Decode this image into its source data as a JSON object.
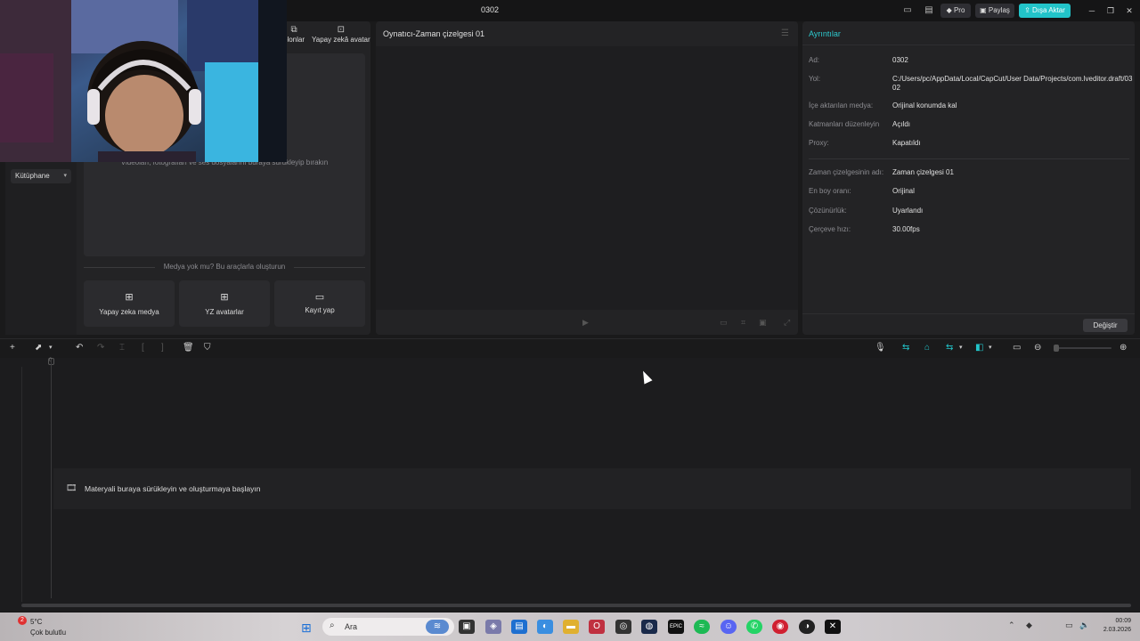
{
  "window": {
    "title": "0302",
    "pro_label": "Pro",
    "share_label": "Paylaş",
    "export_label": "Dışa Aktar"
  },
  "media_panel": {
    "tabs": [
      {
        "label": "blonlar",
        "icon": "template-icon"
      },
      {
        "label": "Yapay zekâ avatar",
        "icon": "ai-avatar-icon"
      }
    ],
    "library_label": "Kütüphane",
    "drop_hint": "Videoları, fotoğrafları ve ses dosyalarını buraya sürükleyip bırakın",
    "no_media_text": "Medya yok mu? Bu araçlarla oluşturun",
    "tools": [
      {
        "label": "Yapay zeka medya",
        "icon": "ai-media-icon"
      },
      {
        "label": "YZ avatarlar",
        "icon": "ai-avatar-icon"
      },
      {
        "label": "Kayıt yap",
        "icon": "record-icon"
      }
    ]
  },
  "player": {
    "title": "Oynatıcı-Zaman çizelgesi 01"
  },
  "details": {
    "title": "Ayrıntılar",
    "rows": [
      {
        "key": "Ad:",
        "value": "0302"
      },
      {
        "key": "Yol:",
        "value": "C:/Users/pc/AppData/Local/CapCut/User Data/Projects/com.lveditor.draft/0302"
      },
      {
        "key": "İçe aktarılan medya:",
        "value": "Orijinal konumda kal"
      },
      {
        "key": "Katmanları düzenleyin",
        "value": "Açıldı"
      },
      {
        "key": "Proxy:",
        "value": "Kapatıldı"
      }
    ],
    "timeline_rows": [
      {
        "key": "Zaman çizelgesinin adı:",
        "value": "Zaman çizelgesi 01"
      },
      {
        "key": "En boy oranı:",
        "value": "Orijinal"
      },
      {
        "key": "Çözünürlük:",
        "value": "Uyarlandı"
      },
      {
        "key": "Çerçeve hızı:",
        "value": "30.00fps"
      }
    ],
    "change_label": "Değiştir"
  },
  "timeline": {
    "start_marker": "0",
    "track_hint": "Materyali buraya sürükleyin ve oluşturmaya başlayın"
  },
  "taskbar": {
    "weather_badge": "2",
    "temperature": "5°C",
    "weather_desc": "Çok bulutlu",
    "search_placeholder": "Ara",
    "time": "00:09",
    "date": "2.03.2026"
  },
  "colors": {
    "accent": "#22c4c9",
    "panel_bg": "#232325",
    "app_bg": "#1a1a1b"
  }
}
